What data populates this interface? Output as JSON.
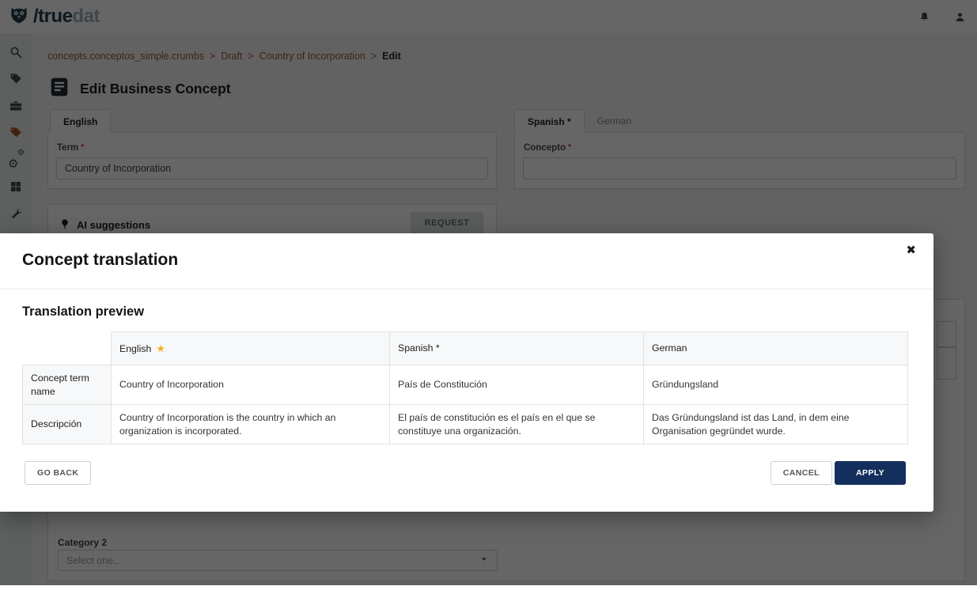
{
  "colors": {
    "accent_rust": "#a8501f",
    "navy_primary": "#142f5e",
    "star_gold": "#f2b01e",
    "link_breadcrumb": "#a2552f"
  },
  "topbar": {
    "logo_primary": "/true",
    "logo_secondary": "dat",
    "icons": [
      "owl-logo-icon",
      "bell-icon",
      "user-icon"
    ]
  },
  "sidebar": {
    "icons": [
      "search-icon",
      "tags-icon",
      "briefcase-icon",
      "concepts-tags-icon-active",
      "gears-icon",
      "grid-icon",
      "wrench-icon"
    ],
    "active_index": 3
  },
  "breadcrumb": {
    "items": [
      "concepts.conceptos_simple.crumbs",
      "Draft",
      "Country of Incorporation"
    ],
    "sep": ">",
    "current": "Edit"
  },
  "page": {
    "title": "Edit Business Concept",
    "title_icon": "book-icon"
  },
  "left_form": {
    "tab_label": "English",
    "field_label": "Term",
    "required_mark": "*",
    "field_value": "Country of Incorporation"
  },
  "right_form": {
    "tab_spanish": "Spanish *",
    "tab_german": "German",
    "field_label": "Concepto",
    "required_mark": "*",
    "field_value": ""
  },
  "ai": {
    "icon": "lightbulb-icon",
    "title": "AI suggestions",
    "request_label": "REQUEST"
  },
  "category2": {
    "label": "Category 2",
    "placeholder": "Select one...",
    "icon": "chevron-down-icon"
  },
  "modal": {
    "title": "Concept translation",
    "subtitle": "Translation preview",
    "close": "✖",
    "table": {
      "headers": [
        "",
        "English",
        "Spanish *",
        "German"
      ],
      "primary_language_icon": "star-icon",
      "star": "★",
      "rows": [
        {
          "label": "Concept term name",
          "en": "Country of Incorporation",
          "es": "País de Constitución",
          "de": "Gründungsland"
        },
        {
          "label": "Descripción",
          "en": "Country of Incorporation is the country in which an organization is incorporated.",
          "es": "El país de constitución es el país en el que se constituye una organización.",
          "de": "Das Gründungsland ist das Land, in dem eine Organisation gegründet wurde."
        }
      ]
    },
    "buttons": {
      "go_back": "GO BACK",
      "cancel": "CANCEL",
      "apply": "APPLY"
    }
  }
}
